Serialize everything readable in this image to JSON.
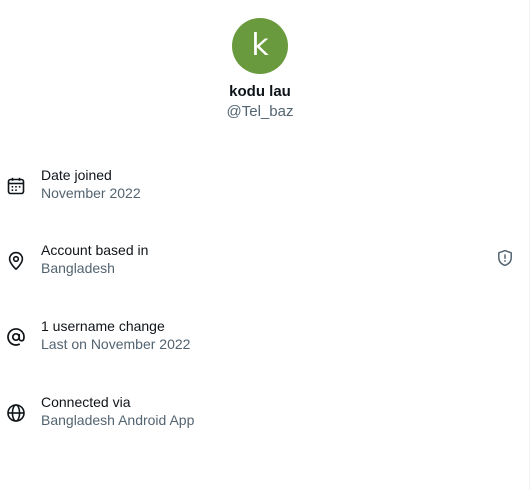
{
  "profile": {
    "avatar_letter": "k",
    "avatar_color": "#6a9a3e",
    "display_name": "kodu lau",
    "handle": "@Tel_baz"
  },
  "details": [
    {
      "icon": "calendar-icon",
      "label": "Date joined",
      "value": "November 2022"
    },
    {
      "icon": "location-pin-icon",
      "label": "Account based in",
      "value": "Bangladesh",
      "trailing_icon": "shield-alert-icon"
    },
    {
      "icon": "at-sign-icon",
      "label": "1 username change",
      "value": "Last on November 2022"
    },
    {
      "icon": "globe-icon",
      "label": "Connected via",
      "value": "Bangladesh Android App"
    }
  ],
  "colors": {
    "primary_text": "#0f1419",
    "secondary_text": "#536471"
  }
}
